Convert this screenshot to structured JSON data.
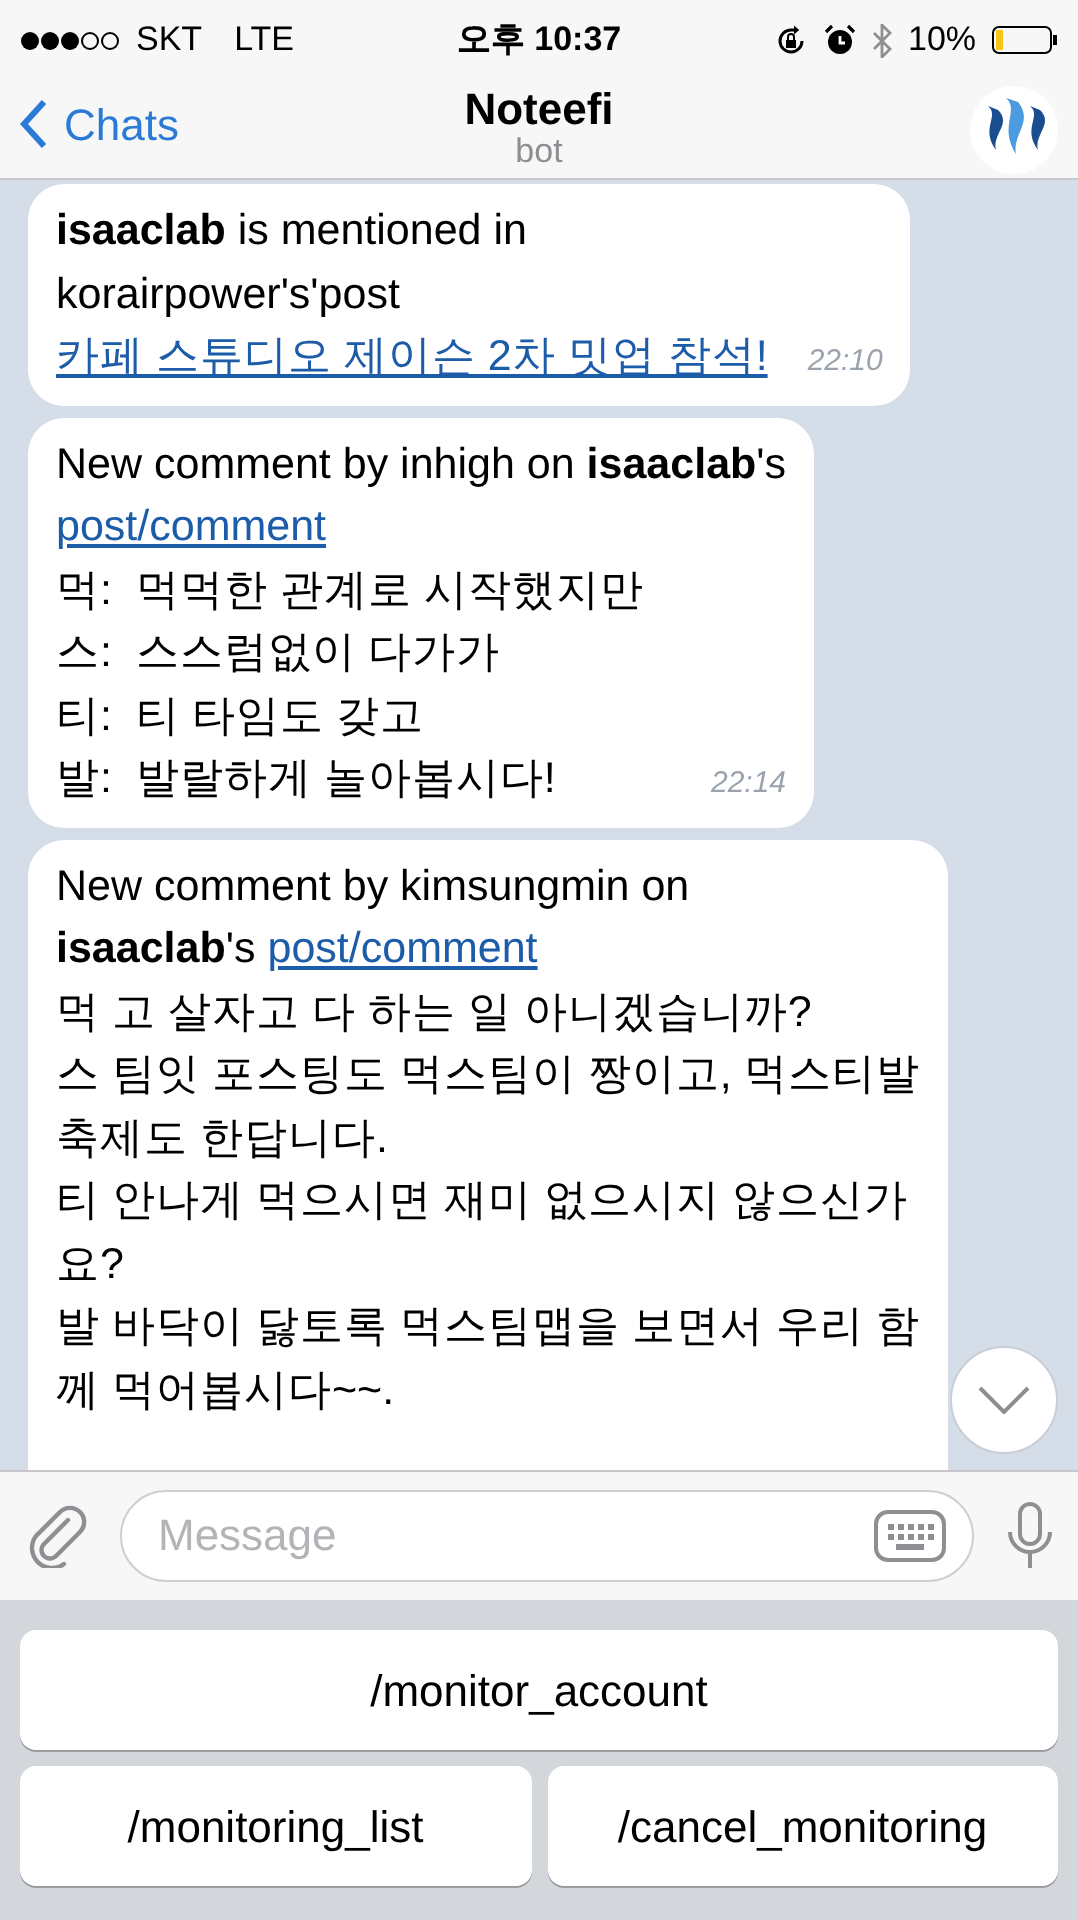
{
  "status_bar": {
    "carrier": "SKT",
    "network": "LTE",
    "time": "오후 10:37",
    "battery": "10%"
  },
  "nav": {
    "back": "Chats",
    "title": "Noteefi",
    "subtitle": "bot"
  },
  "messages": [
    {
      "time": "22:10",
      "lines": [
        [
          {
            "kind": "text",
            "text": "**isaaclab** is mentioned in"
          }
        ],
        [
          {
            "kind": "text",
            "text": "korairpower's'post"
          }
        ],
        [
          {
            "kind": "link",
            "text": "카페 스튜디오 제이슨 2차 밋업 참석!"
          }
        ]
      ]
    },
    {
      "time": "22:14",
      "lines": [
        [
          {
            "kind": "text",
            "text": "New comment by inhigh on **isaaclab**'s"
          }
        ],
        [
          {
            "kind": "link",
            "text": "post/comment"
          }
        ],
        [
          {
            "kind": "text",
            "text": "먹:  먹먹한 관계로 시작했지만"
          }
        ],
        [
          {
            "kind": "text",
            "text": "스:  스스럼없이 다가가"
          }
        ],
        [
          {
            "kind": "text",
            "text": "티:  티 타임도 갖고"
          }
        ],
        [
          {
            "kind": "text",
            "text": "발:  발랄하게 놀아봅시다!"
          }
        ]
      ]
    },
    {
      "lines": [
        [
          {
            "kind": "text",
            "text": "New comment by kimsungmin on"
          }
        ],
        [
          {
            "kind": "text",
            "text": "**isaaclab**'s"
          },
          {
            "kind": "link",
            "text": "post/comment"
          }
        ],
        [
          {
            "kind": "text",
            "text": "먹 고 살자고 다 하는 일 아니겠습니까?"
          }
        ],
        [
          {
            "kind": "text",
            "text": "스 팀잇 포스팅도 먹스팀이 짱이고, 먹스티발"
          }
        ],
        [
          {
            "kind": "text",
            "text": "축제도 한답니다."
          }
        ],
        [
          {
            "kind": "text",
            "text": "티 안나게 먹으시면 재미 없으시지 않으신가"
          }
        ],
        [
          {
            "kind": "text",
            "text": "요?"
          }
        ],
        [
          {
            "kind": "text",
            "text": "발 바닥이 닳토록 먹스팀맵을 보면서 우리 함"
          }
        ],
        [
          {
            "kind": "text",
            "text": "께 먹어봅시다~~."
          }
        ]
      ]
    }
  ],
  "composer": {
    "placeholder": "Message"
  },
  "keyboard": [
    [
      "/monitor_account"
    ],
    [
      "/monitoring_list",
      "/cancel_monitoring"
    ]
  ]
}
